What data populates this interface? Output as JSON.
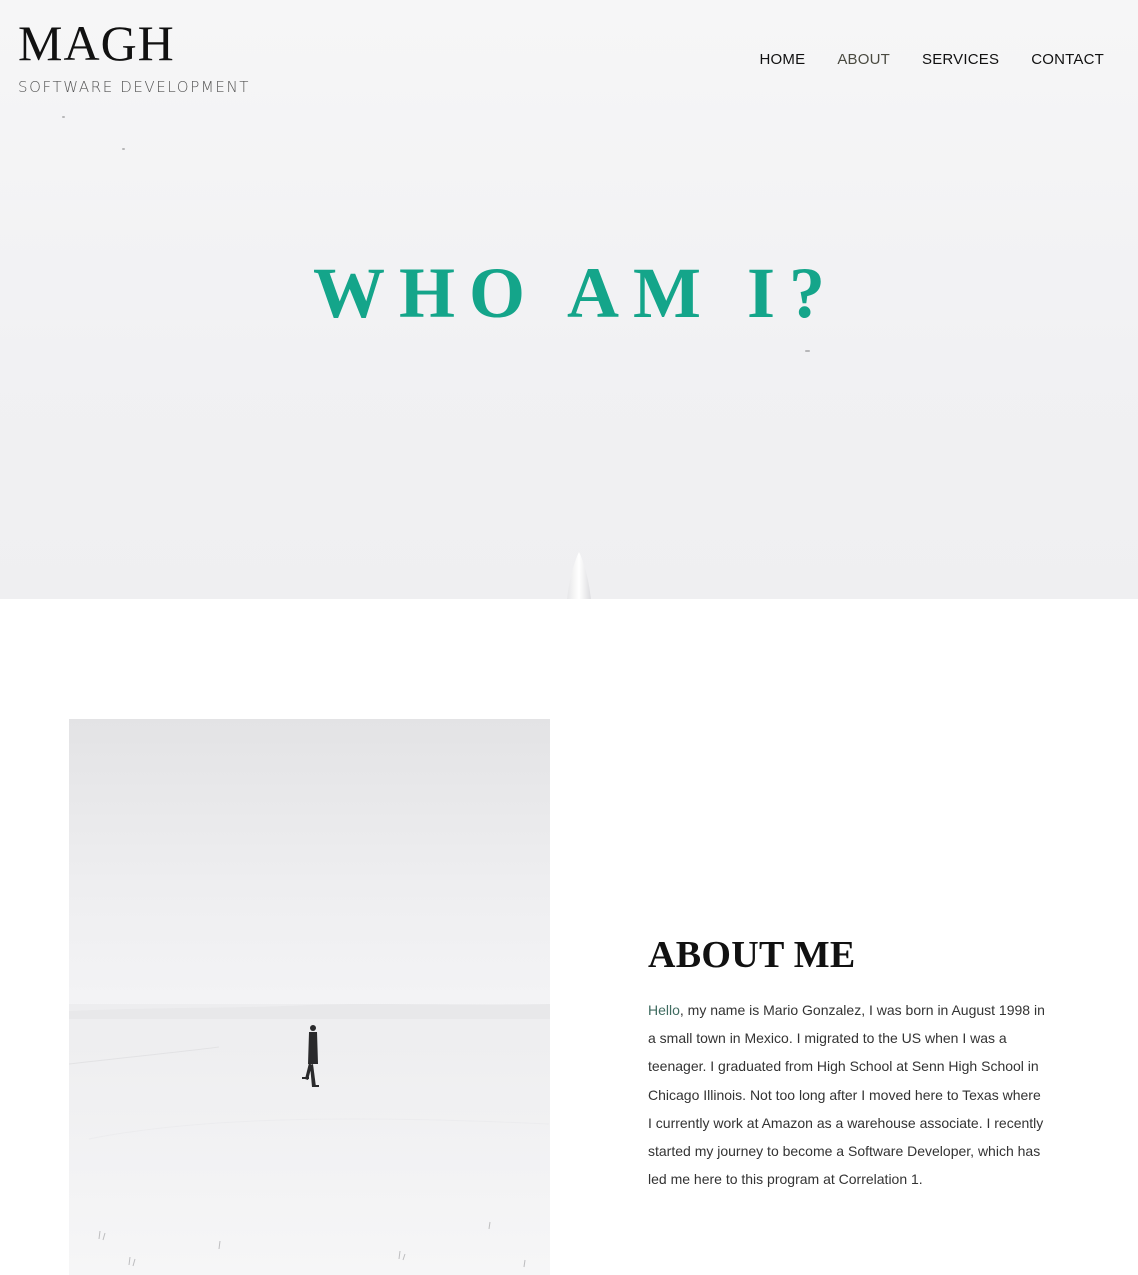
{
  "brand": {
    "name": "MAGH",
    "tagline": "SOFTWARE DEVELOPMENT"
  },
  "nav": {
    "items": [
      {
        "label": "HOME",
        "active": false
      },
      {
        "label": "ABOUT",
        "active": true
      },
      {
        "label": "SERVICES",
        "active": false
      },
      {
        "label": "CONTACT",
        "active": false
      }
    ]
  },
  "hero": {
    "title": "WHO AM I?",
    "title_color": "#14a58a"
  },
  "about": {
    "heading": "ABOUT ME",
    "intro_word": "Hello",
    "body": ", my name is Mario Gonzalez, I was born in August 1998 in a small town in Mexico. I migrated to the US when I was a teenager. I graduated from High School at Senn High School in Chicago Illinois. Not too long after I moved here to Texas where I currently work at Amazon as a warehouse associate. I recently started my journey to become a Software Developer, which has led me here to this program at Correlation 1.",
    "photo": "person-walking-snowfield-image"
  }
}
